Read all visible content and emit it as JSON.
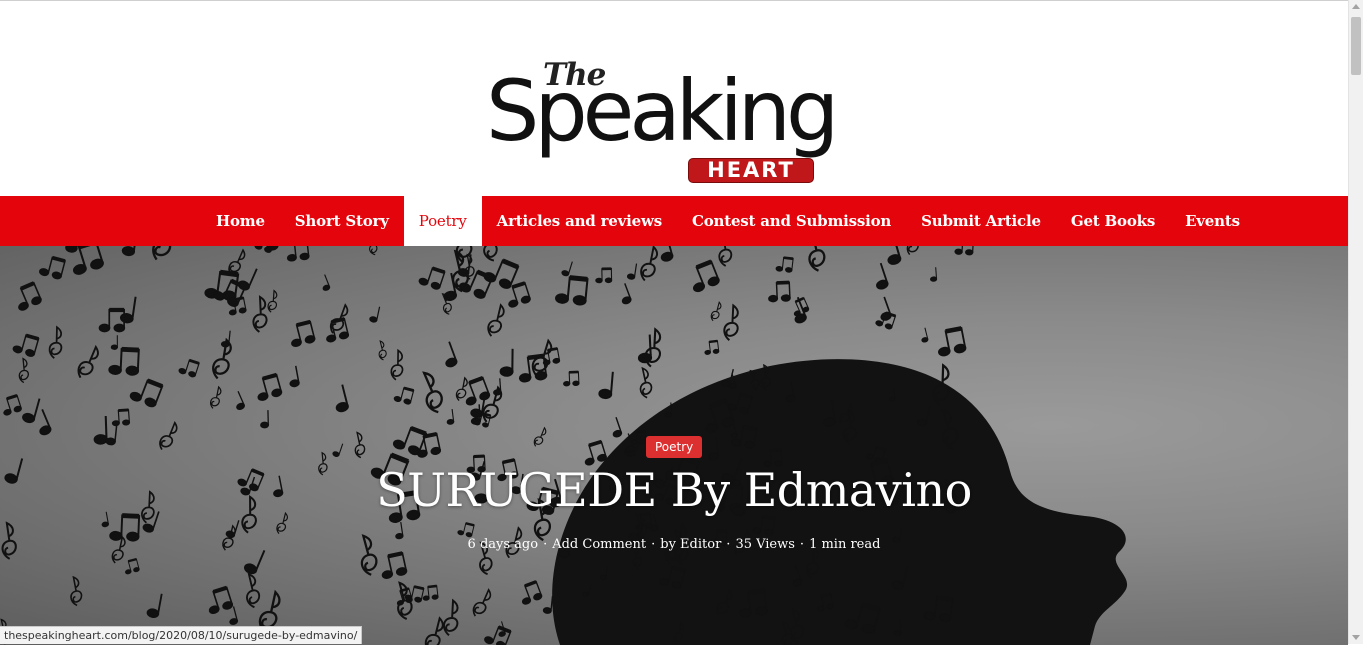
{
  "logo": {
    "the": "The",
    "speaking": "Speaking",
    "heart": "HEART"
  },
  "nav": {
    "items": [
      {
        "label": "Home"
      },
      {
        "label": "Short Story"
      },
      {
        "label": "Poetry"
      },
      {
        "label": "Articles and reviews"
      },
      {
        "label": "Contest and Submission"
      },
      {
        "label": "Submit Article"
      },
      {
        "label": "Get Books"
      },
      {
        "label": "Events"
      }
    ],
    "active": "Poetry"
  },
  "post": {
    "category": "Poetry",
    "title": "SURUGEDE By Edmavino",
    "meta": {
      "date": "6 days ago",
      "comments": "Add Comment",
      "author": "by Editor",
      "views": "35 Views",
      "read_time": "1 min read"
    }
  },
  "status_url": "thespeakingheart.com/blog/2020/08/10/surugede-by-edmavino/",
  "colors": {
    "nav_bg": "#e4050c",
    "badge_bg": "#dc2f2f",
    "heart_bg": "#c0171a"
  }
}
